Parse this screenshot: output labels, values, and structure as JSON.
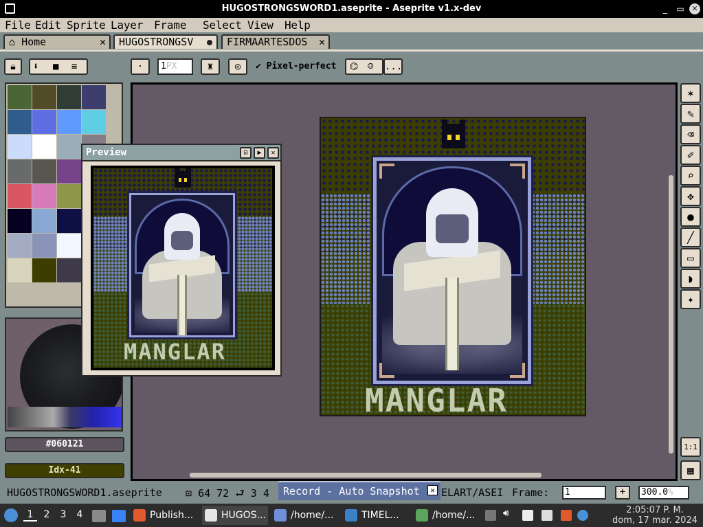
{
  "window": {
    "title": "HUGOSTRONGSWORD1.aseprite - Aseprite v1.x-dev",
    "minimize_glyph": "_",
    "maximize_glyph": "▭",
    "close_glyph": "✕"
  },
  "menu": [
    "File",
    "Edit",
    "Sprite",
    "Layer",
    "Frame",
    "Select",
    "View",
    "Help"
  ],
  "tabs": [
    {
      "label": "Home",
      "icon": "home-icon",
      "close": "✕"
    },
    {
      "label": "HUGOSTRONGSV",
      "modified": true
    },
    {
      "label": "FIRMAARTESDOS",
      "close": "✕"
    }
  ],
  "toolbar": {
    "brush_size_value": "1",
    "brush_size_placeholder": "PX",
    "pixel_perfect_label": "Pixel-perfect",
    "pixel_perfect_checked": true,
    "more_label": "..."
  },
  "palette": {
    "swatches": [
      "#4c6536",
      "#514b28",
      "#303d36",
      "#3d3d6e",
      "#2f5c8a",
      "#5e6ee5",
      "#5f9bff",
      "#5fcde4",
      "#cbdbfc",
      "#ffffff",
      "#9badb7",
      "#847e87",
      "#696a6a",
      "#595652",
      "#76428a",
      "#ac3232",
      "#d95763",
      "#d77bba",
      "#8f974a",
      "#8a6f30",
      "#060121",
      "#89a8d4",
      "#0e0f45",
      "#c9c9ff",
      "#a4acc4",
      "#8a93b8",
      "#f2f7ff",
      "#2c2c56",
      "#d8d4bd",
      "#3b3e00",
      "#3f3a4a",
      "#000000"
    ]
  },
  "color": {
    "hex_label": "#060121",
    "index_label": "Idx-41",
    "fg": "#060121",
    "bg": "#3b3e00"
  },
  "preview": {
    "title": "Preview",
    "buttons": [
      "⊡",
      "▶",
      "✕"
    ],
    "art_text": "MANGLAR"
  },
  "canvas": {
    "art_text": "MANGLAR"
  },
  "tools": [
    "✶",
    "✎",
    "⌫",
    "✐",
    "⌕",
    "✥",
    "●",
    "╱",
    "▭",
    "◗",
    "✦"
  ],
  "bottom_tools": [
    "1:1",
    "▦"
  ],
  "status": {
    "filename": "HUGOSTRONGSWORD1.aseprite",
    "x": "64",
    "y": "72",
    "size_icon": "⮐",
    "size_w": "3",
    "size_h": "4",
    "record_label": "Record - Auto Snapshot",
    "record_close": "✕",
    "path_fragment": "ELART/ASEI",
    "frame_label": "Frame:",
    "frame_value": "1",
    "plus_label": "+",
    "zoom_value": "300.0",
    "zoom_unit": "%"
  },
  "taskbar": {
    "workspaces": [
      "1",
      "2",
      "3",
      "4"
    ],
    "tasks": [
      {
        "label": "Publish...",
        "color": "#e05a2b"
      },
      {
        "label": "HUGOS...",
        "color": "#e6e6e6"
      },
      {
        "label": "/home/...",
        "color": "#6f8fd8"
      },
      {
        "label": "TIMEL...",
        "color": "#3b82c4"
      },
      {
        "label": "/home/...",
        "color": "#5ba45b"
      }
    ],
    "clock_time": "2:05:07 P. M.",
    "clock_date": "dom, 17 mar. 2024"
  }
}
